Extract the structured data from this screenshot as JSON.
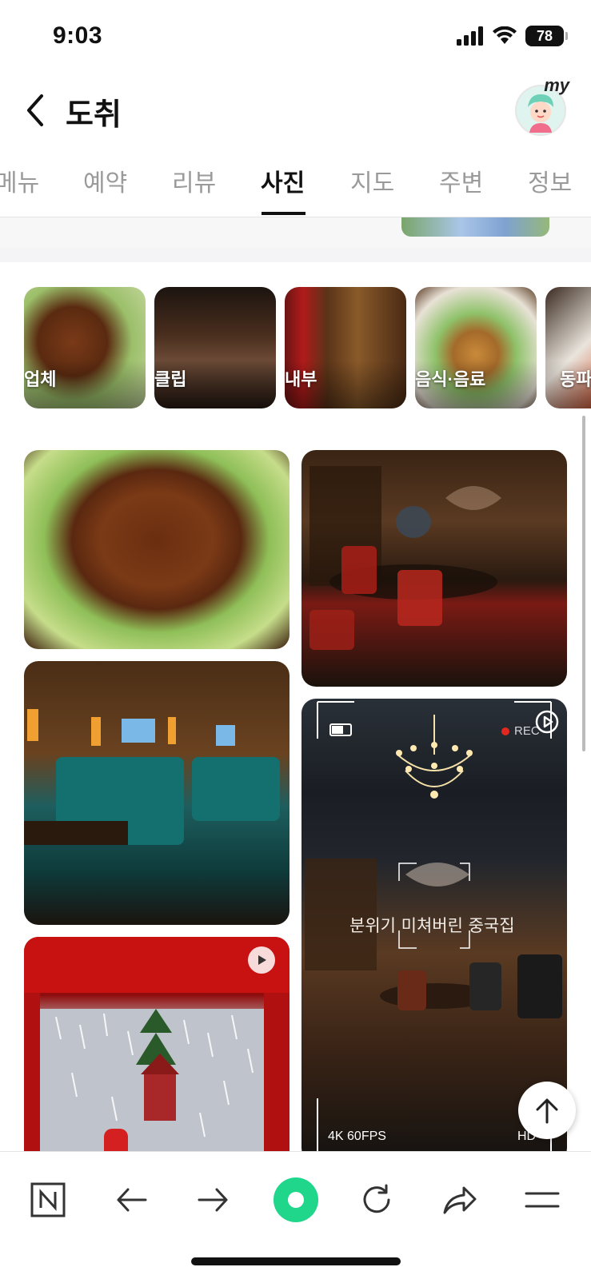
{
  "status_bar": {
    "time": "9:03",
    "battery": "78"
  },
  "header": {
    "title": "도취",
    "avatar_badge": "my"
  },
  "tabs": [
    {
      "label": "메뉴"
    },
    {
      "label": "예약"
    },
    {
      "label": "리뷰"
    },
    {
      "label": "사진",
      "active": true
    },
    {
      "label": "지도"
    },
    {
      "label": "주변"
    },
    {
      "label": "정보"
    }
  ],
  "categories": [
    {
      "label": "업체"
    },
    {
      "label": "클립"
    },
    {
      "label": "내부"
    },
    {
      "label": "음식·음료"
    },
    {
      "label": "동파"
    }
  ],
  "photos": {
    "clip_overlay": {
      "caption": "분위기 미쳐버린 중국집",
      "rec": "REC",
      "quality_left": "4K 60FPS",
      "quality_right": "HD"
    }
  },
  "colors": {
    "accent": "#03c75a",
    "tab_active": "#111111",
    "tab_inactive": "#9a9a9a"
  },
  "toolbar": {
    "icons": [
      "naver-home-icon",
      "back-arrow-icon",
      "forward-arrow-icon",
      "green-dot-icon",
      "refresh-icon",
      "share-icon",
      "menu-icon"
    ]
  }
}
